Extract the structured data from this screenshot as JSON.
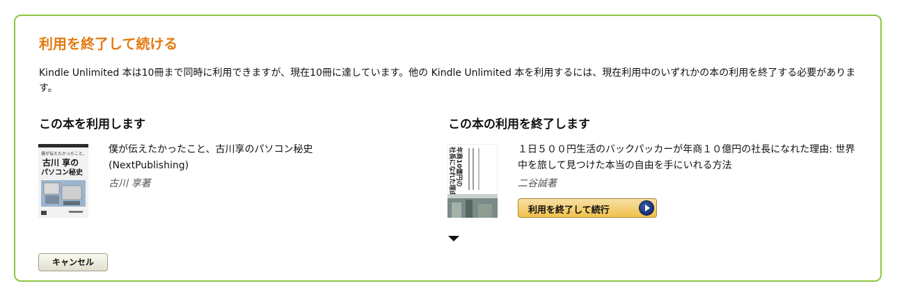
{
  "dialog": {
    "title": "利用を終了して続ける",
    "description": "Kindle Unlimited 本は10冊まで同時に利用できますが、現在10冊に達しています。他の Kindle Unlimited 本を利用するには、現在利用中のいずれかの本の利用を終了する必要があります。"
  },
  "borrow": {
    "heading": "この本を利用します",
    "book": {
      "title": "僕が伝えたかったこと、古川享のパソコン秘史 (NextPublishing)",
      "author": "古川 享著",
      "cover_text": [
        "僕が伝えたかったこと、",
        "古川 享の",
        "パソコン秘史"
      ]
    }
  },
  "return": {
    "heading": "この本の利用を終了します",
    "book": {
      "title": "１日５００円生活のバックパッカーが年商１０億円の社長になれた理由: 世界中を旅して見つけた本当の自由を手にいれる方法",
      "author": "二谷誠著",
      "cover_text": [
        "年商10億円の",
        "社長になれた理由"
      ]
    },
    "button_label": "利用を終了して続行"
  },
  "actions": {
    "cancel_label": "キャンセル"
  },
  "colors": {
    "accent": "#e47911",
    "border": "#8dc63f",
    "button_yellow": "#f0c14b"
  }
}
